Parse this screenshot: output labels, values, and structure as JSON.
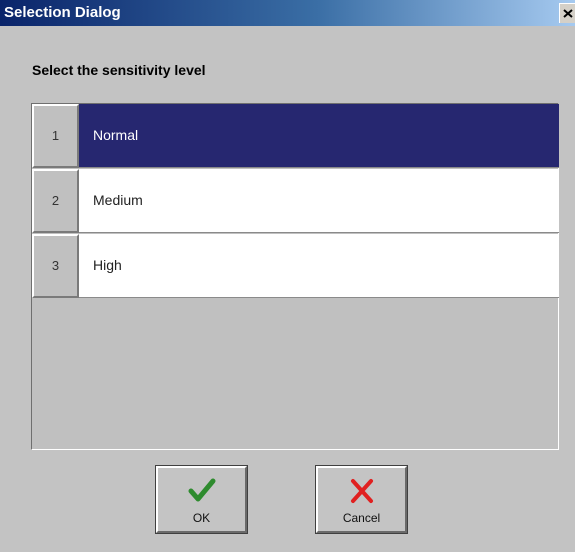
{
  "window": {
    "title": "Selection Dialog",
    "close_icon": "close-icon"
  },
  "prompt": "Select the sensitivity level",
  "options": [
    {
      "number": "1",
      "label": "Normal",
      "selected": true
    },
    {
      "number": "2",
      "label": "Medium",
      "selected": false
    },
    {
      "number": "3",
      "label": "High",
      "selected": false
    }
  ],
  "buttons": {
    "ok": {
      "label": "OK",
      "icon": "checkmark-icon",
      "color": "#2e8b2e"
    },
    "cancel": {
      "label": "Cancel",
      "icon": "x-mark-icon",
      "color": "#e02020"
    }
  },
  "colors": {
    "selected_row": "#262770",
    "title_bar": "#0a246a"
  }
}
